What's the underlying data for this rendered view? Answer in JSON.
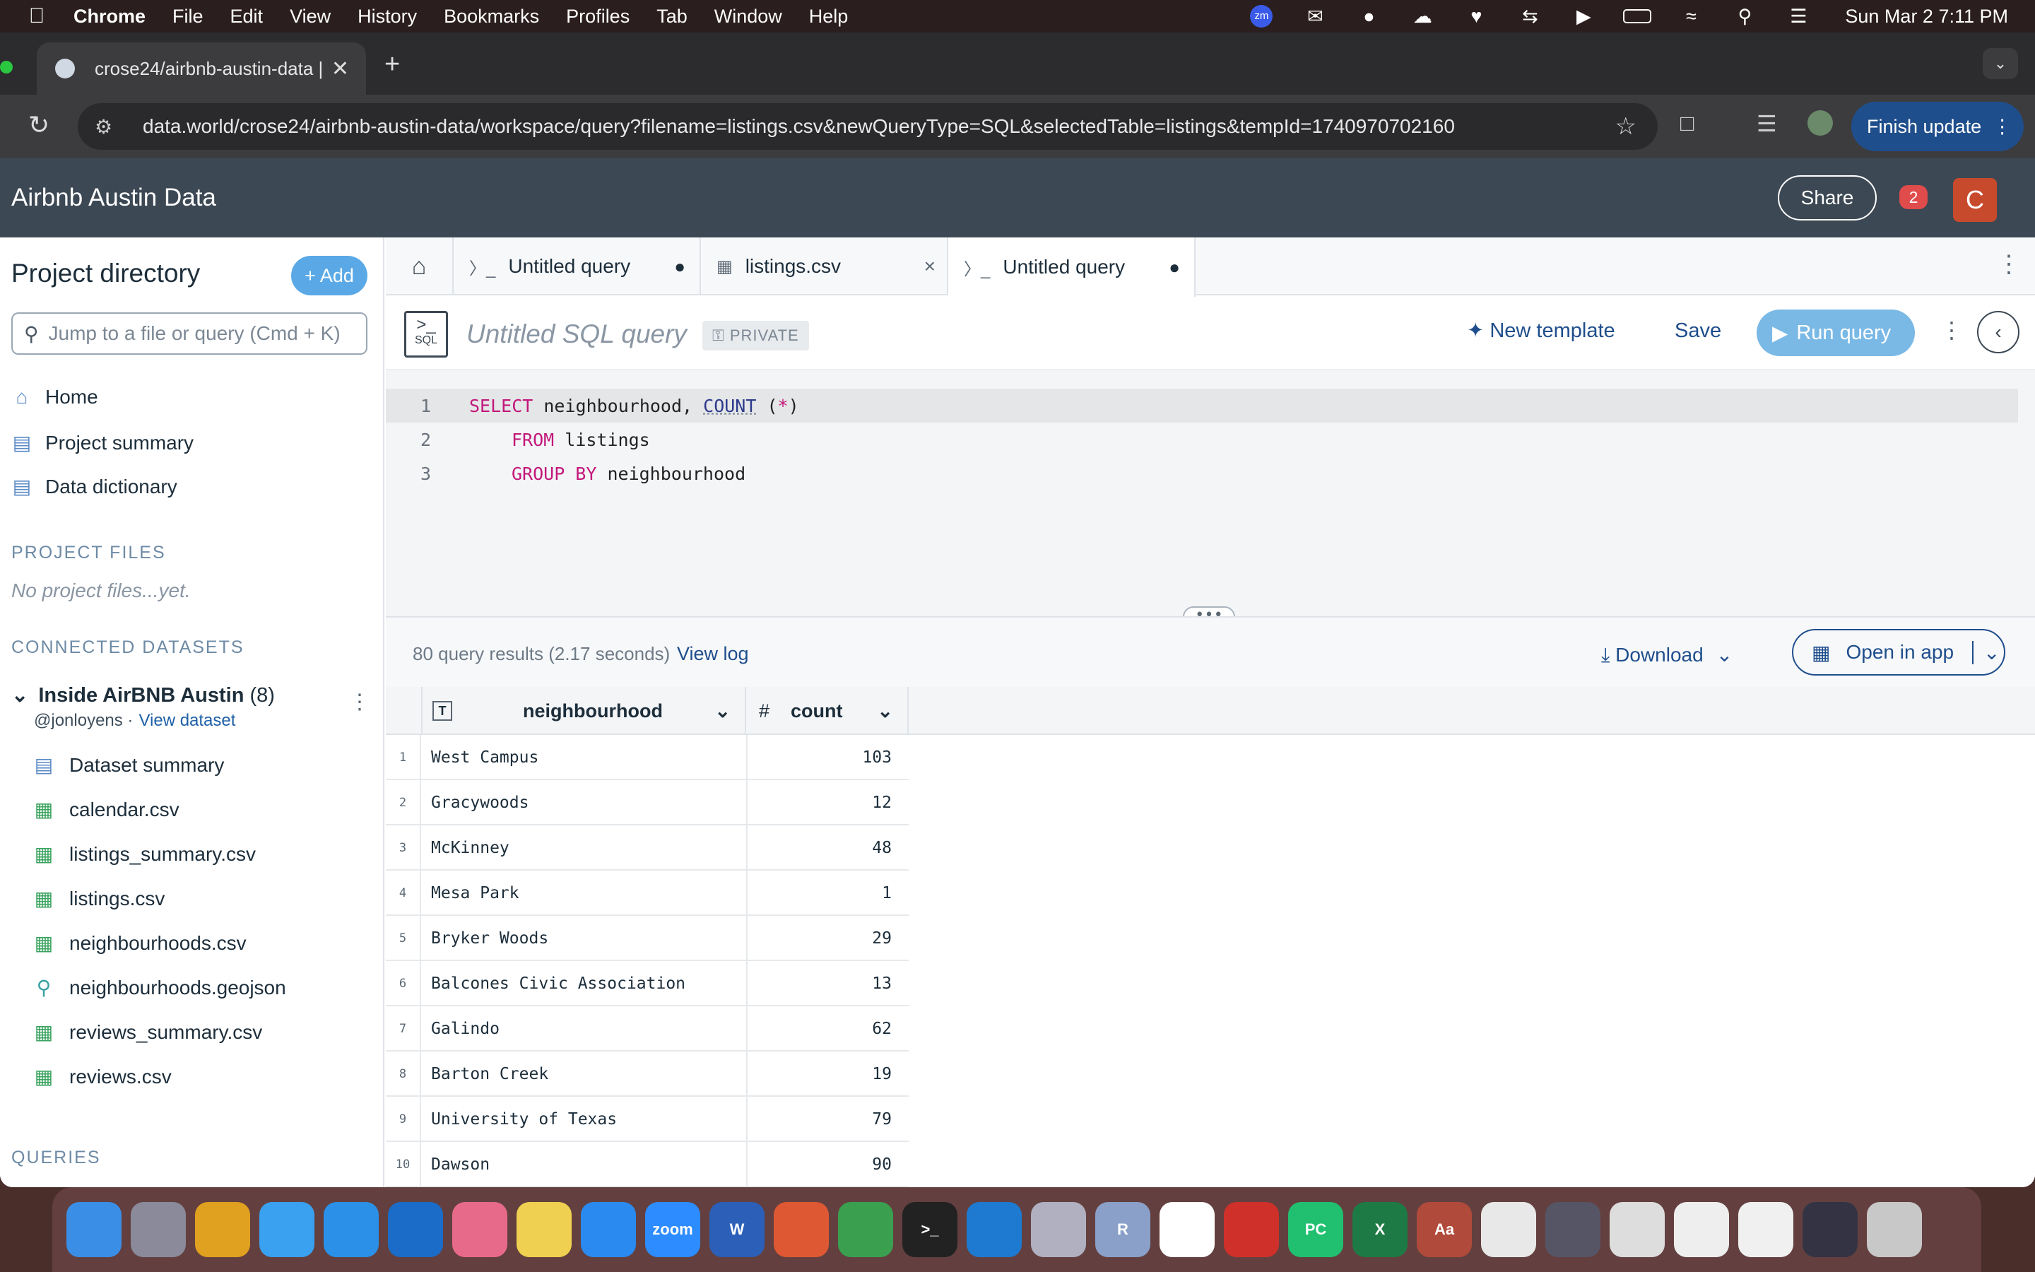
{
  "menubar": {
    "app": "Chrome",
    "items": [
      "File",
      "Edit",
      "View",
      "History",
      "Bookmarks",
      "Profiles",
      "Tab",
      "Window",
      "Help"
    ],
    "clock": "Sun Mar 2  7:11 PM",
    "tray_icons": [
      "zoom-icon",
      "outlook-icon",
      "globe-icon",
      "cloud-icon",
      "gmail-icon",
      "sync-icon",
      "play-icon",
      "battery-icon",
      "wifi-icon",
      "search-icon",
      "control-center-icon"
    ]
  },
  "browser": {
    "tab_title": "crose24/airbnb-austin-data |",
    "url": "data.world/crose24/airbnb-austin-data/workspace/query?filename=listings.csv&newQueryType=SQL&selectedTable=listings&tempId=1740970702160",
    "finish_update": "Finish update"
  },
  "app": {
    "title": "Airbnb Austin Data",
    "share": "Share",
    "notifications": "2",
    "avatar": "C"
  },
  "sidebar": {
    "title": "Project directory",
    "add": "+ Add",
    "search_placeholder": "Jump to a file or query (Cmd + K)",
    "nav": [
      "Home",
      "Project summary",
      "Data dictionary"
    ],
    "project_files_header": "PROJECT FILES",
    "project_files_empty": "No project files...yet.",
    "connected_header": "CONNECTED DATASETS",
    "dataset": {
      "name": "Inside AirBNB Austin",
      "count": "(8)",
      "owner": "@jonloyens ·",
      "view": "View dataset"
    },
    "files": [
      "Dataset summary",
      "calendar.csv",
      "listings_summary.csv",
      "listings.csv",
      "neighbourhoods.csv",
      "neighbourhoods.geojson",
      "reviews_summary.csv",
      "reviews.csv"
    ],
    "queries_header": "QUERIES"
  },
  "editor_tabs": [
    {
      "label": "Untitled query",
      "marker": "●"
    },
    {
      "label": "listings.csv",
      "marker": "×"
    },
    {
      "label": "Untitled query",
      "marker": "●"
    }
  ],
  "query": {
    "title": "Untitled SQL query",
    "badge": "PRIVATE",
    "new_template": "New template",
    "save": "Save",
    "run": "Run query",
    "sql_icon_label": "SQL",
    "lines": [
      {
        "n": "1",
        "kw1": "SELECT",
        "t1": " neighbourhood, ",
        "fn": "COUNT",
        "t2": " (",
        "star": "*",
        "t3": ")"
      },
      {
        "n": "2",
        "kw1": "FROM",
        "t1": " listings"
      },
      {
        "n": "3",
        "kw1": "GROUP BY",
        "t1": " neighbourhood"
      }
    ]
  },
  "results": {
    "summary": "80 query results (2.17 seconds)",
    "view_log": "View log",
    "download": "Download",
    "open_in_app": "Open in app",
    "columns": [
      {
        "name": "neighbourhood",
        "type_icon": "T"
      },
      {
        "name": "count",
        "type_icon": "#"
      }
    ],
    "rows": [
      {
        "n": "1",
        "neighbourhood": "West Campus",
        "count": "103"
      },
      {
        "n": "2",
        "neighbourhood": "Gracywoods",
        "count": "12"
      },
      {
        "n": "3",
        "neighbourhood": "McKinney",
        "count": "48"
      },
      {
        "n": "4",
        "neighbourhood": "Mesa Park",
        "count": "1"
      },
      {
        "n": "5",
        "neighbourhood": "Bryker Woods",
        "count": "29"
      },
      {
        "n": "6",
        "neighbourhood": "Balcones Civic Association",
        "count": "13"
      },
      {
        "n": "7",
        "neighbourhood": "Galindo",
        "count": "62"
      },
      {
        "n": "8",
        "neighbourhood": "Barton Creek",
        "count": "19"
      },
      {
        "n": "9",
        "neighbourhood": "University of Texas",
        "count": "79"
      },
      {
        "n": "10",
        "neighbourhood": "Dawson",
        "count": "90"
      }
    ]
  },
  "dock": {
    "apps": [
      {
        "name": "finder",
        "color": "#3a8ee6",
        "label": ""
      },
      {
        "name": "launchpad",
        "color": "#8a8a9a",
        "label": ""
      },
      {
        "name": "chrome",
        "color": "#e0a020",
        "label": ""
      },
      {
        "name": "mail",
        "color": "#3aa0f0",
        "label": ""
      },
      {
        "name": "safari",
        "color": "#2a90e8",
        "label": ""
      },
      {
        "name": "outlook",
        "color": "#1a6cc8",
        "label": ""
      },
      {
        "name": "photos",
        "color": "#e86a8a",
        "label": ""
      },
      {
        "name": "notes",
        "color": "#f0d050",
        "label": ""
      },
      {
        "name": "app-store",
        "color": "#2a8af0",
        "label": ""
      },
      {
        "name": "zoom",
        "color": "#2d8cff",
        "label": "zoom"
      },
      {
        "name": "word",
        "color": "#2b5fb8",
        "label": "W"
      },
      {
        "name": "duckduckgo",
        "color": "#de5833",
        "label": ""
      },
      {
        "name": "activity",
        "color": "#3aa050",
        "label": ""
      },
      {
        "name": "terminal",
        "color": "#222222",
        "label": ">_"
      },
      {
        "name": "vscode",
        "color": "#1e7ad0",
        "label": ""
      },
      {
        "name": "system",
        "color": "#b0b0c0",
        "label": ""
      },
      {
        "name": "r",
        "color": "#8aa0c8",
        "label": "R"
      },
      {
        "name": "slack",
        "color": "#ffffff",
        "label": ""
      },
      {
        "name": "expressvpn",
        "color": "#d0302a",
        "label": ""
      },
      {
        "name": "pycharm",
        "color": "#20c070",
        "label": "PC"
      },
      {
        "name": "excel",
        "color": "#1e7a44",
        "label": "X"
      },
      {
        "name": "dictionary",
        "color": "#b04a3a",
        "label": "Aa"
      },
      {
        "name": "doc",
        "color": "#e8e8e8",
        "label": ""
      },
      {
        "name": "screenshot1",
        "color": "#555566",
        "label": ""
      },
      {
        "name": "screenshot2",
        "color": "#dddddd",
        "label": ""
      },
      {
        "name": "screenshot3",
        "color": "#eeeeee",
        "label": ""
      },
      {
        "name": "screenshot4",
        "color": "#f0f0f0",
        "label": ""
      },
      {
        "name": "screenshot5",
        "color": "#333344",
        "label": ""
      },
      {
        "name": "trash",
        "color": "#c8c8c8",
        "label": ""
      }
    ]
  }
}
